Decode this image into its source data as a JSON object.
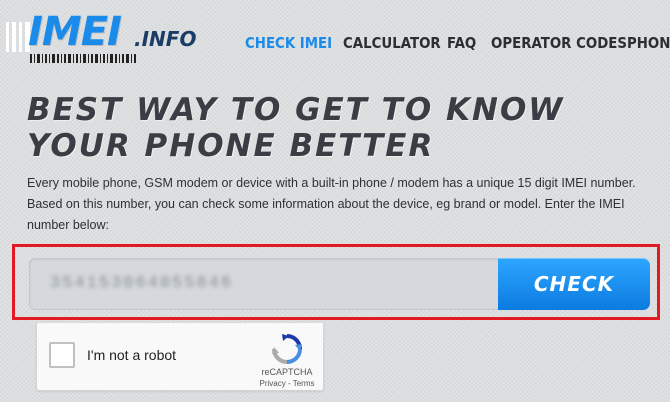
{
  "header": {
    "logo": {
      "main": "IMEI",
      "tld": ".INFO"
    },
    "nav": [
      {
        "label": "CHECK IMEI",
        "active": true
      },
      {
        "label": "CALCULATOR",
        "active": false
      },
      {
        "label": "FAQ",
        "active": false
      },
      {
        "label": "OPERATOR CODES",
        "active": false
      },
      {
        "label": "PHON",
        "active": false
      }
    ]
  },
  "hero": {
    "headline_line1": "BEST WAY TO GET TO KNOW",
    "headline_line2": "YOUR PHONE BETTER",
    "intro": "Every mobile phone, GSM modem or device with a built-in phone / modem has a unique 15 digit IMEI number. Based on this number, you can check some information about the device, eg brand or model. Enter the IMEI number below:"
  },
  "form": {
    "imei_value": "354153064055846",
    "check_label": "CHECK"
  },
  "captcha": {
    "label": "I'm not a robot",
    "brand": "reCAPTCHA",
    "links": "Privacy - Terms"
  },
  "colors": {
    "accent": "#1a8bea",
    "highlight": "#e01b24",
    "text_dark": "#3a3e44"
  }
}
